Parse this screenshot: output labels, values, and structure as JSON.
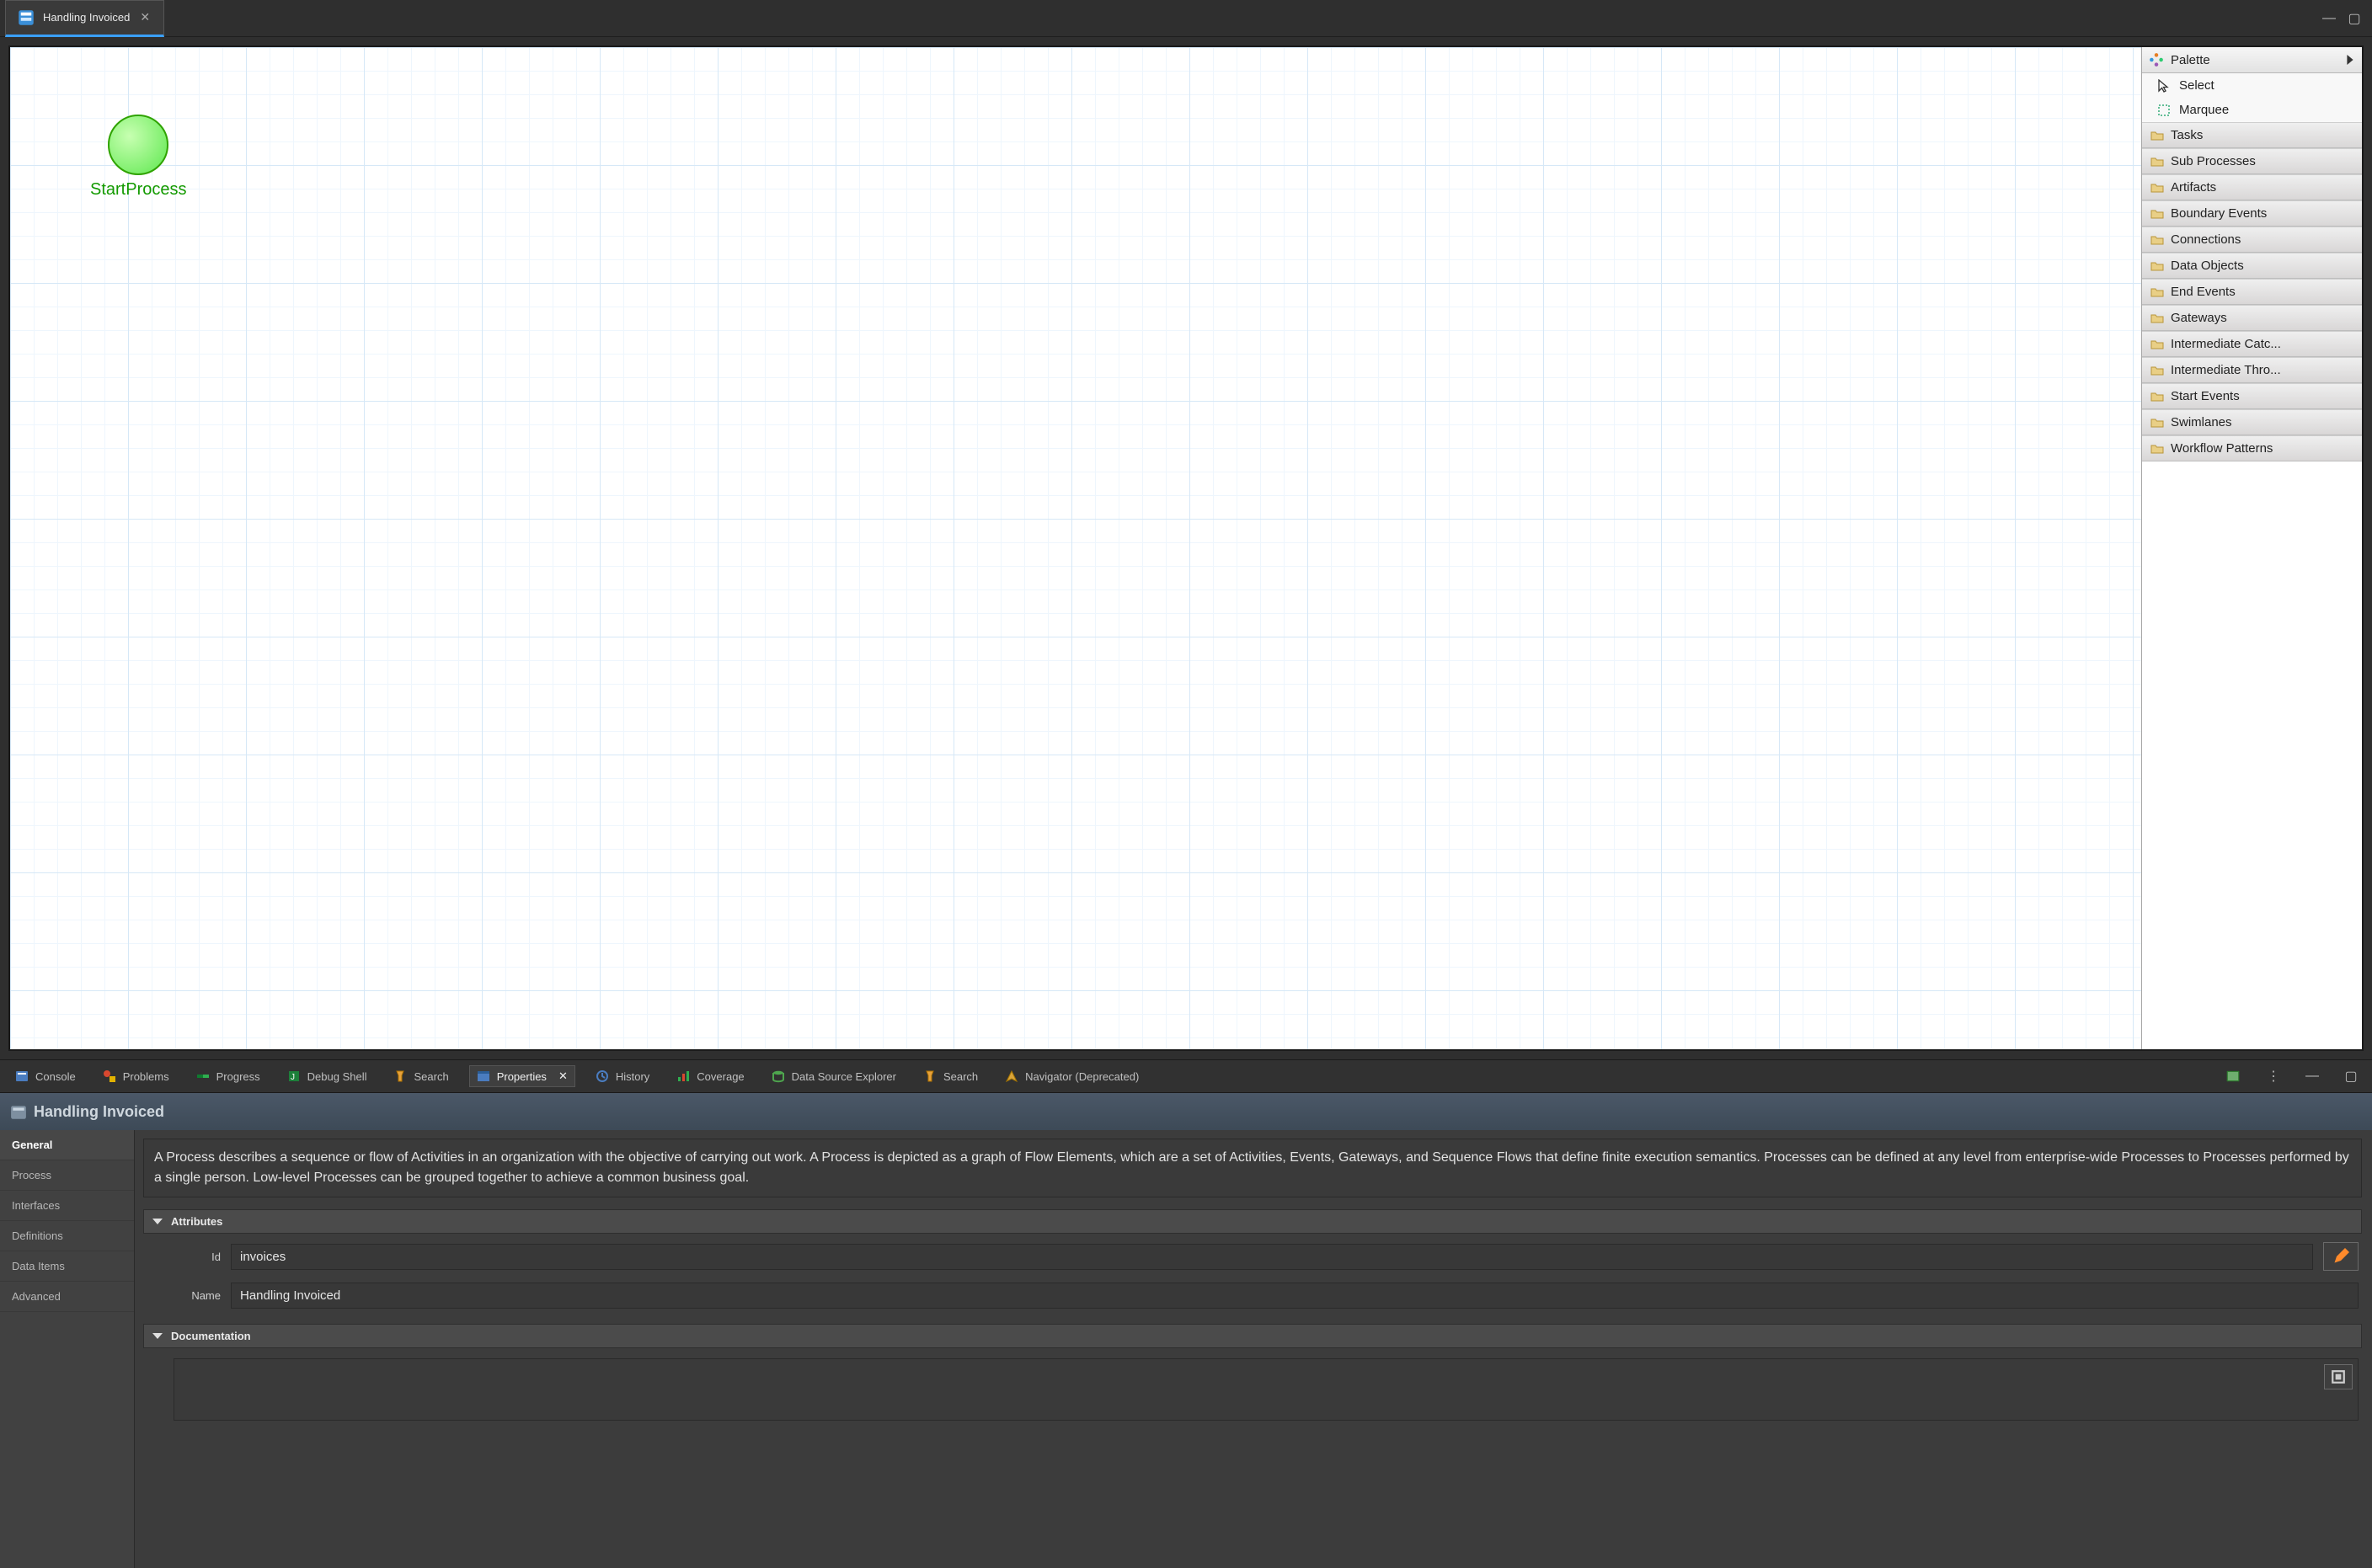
{
  "editor": {
    "tab_title": "Handling Invoiced"
  },
  "canvas": {
    "start_node_label": "StartProcess"
  },
  "palette": {
    "title": "Palette",
    "tools": {
      "select": "Select",
      "marquee": "Marquee"
    },
    "categories": [
      "Tasks",
      "Sub Processes",
      "Artifacts",
      "Boundary Events",
      "Connections",
      "Data Objects",
      "End Events",
      "Gateways",
      "Intermediate Catc...",
      "Intermediate Thro...",
      "Start Events",
      "Swimlanes",
      "Workflow Patterns"
    ]
  },
  "bottomViews": {
    "console": "Console",
    "problems": "Problems",
    "progress": "Progress",
    "debug_shell": "Debug Shell",
    "search": "Search",
    "properties": "Properties",
    "history": "History",
    "coverage": "Coverage",
    "data_source_explorer": "Data Source Explorer",
    "search2": "Search",
    "navigator": "Navigator (Deprecated)"
  },
  "propHeader": {
    "title": "Handling Invoiced"
  },
  "propSideTabs": [
    "General",
    "Process",
    "Interfaces",
    "Definitions",
    "Data Items",
    "Advanced"
  ],
  "general": {
    "description": "A Process describes a sequence or flow of Activities in an organization with the objective of carrying out work. A Process is depicted as a graph of Flow Elements, which are a set of Activities, Events, Gateways, and Sequence Flows that define finite execution semantics. Processes can be defined at any level from enterprise-wide Processes to Processes performed by a single person. Low-level Processes can be grouped together to achieve a common business goal.",
    "attributes_label": "Attributes",
    "id_label": "Id",
    "id_value": "invoices",
    "name_label": "Name",
    "name_value": "Handling Invoiced",
    "documentation_label": "Documentation",
    "documentation_value": ""
  }
}
